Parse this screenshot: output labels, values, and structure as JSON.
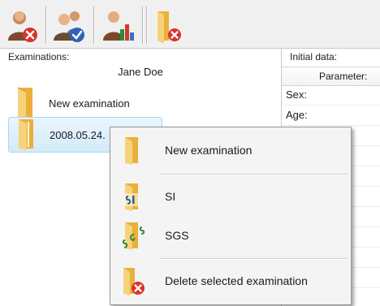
{
  "toolbar": {
    "buttons": [
      {
        "icon": "user-delete-icon"
      },
      {
        "icon": "users-check-icon"
      },
      {
        "icon": "user-chart-icon"
      },
      {
        "icon": "folder-delete-icon"
      }
    ]
  },
  "left_panel": {
    "label": "Examinations:",
    "patient_name": "Jane Doe",
    "items": [
      {
        "label": "New examination",
        "icon": "folder-icon",
        "selected": false
      },
      {
        "label": "2008.05.24.",
        "icon": "folder-open-icon",
        "selected": true
      }
    ]
  },
  "right_panel": {
    "label": "Initial data:",
    "column_header": "Parameter:",
    "rows": [
      {
        "label": "Sex:"
      },
      {
        "label": "Age:"
      }
    ]
  },
  "context_menu": {
    "items": [
      {
        "label": "New examination",
        "icon": "folder-icon"
      },
      {
        "label": "SI",
        "icon": "si-folder-icon"
      },
      {
        "label": "SGS",
        "icon": "sgs-folder-icon"
      },
      {
        "label": "Delete selected examination",
        "icon": "folder-delete-icon"
      }
    ]
  },
  "colors": {
    "selection_bg": "#d4ebfb",
    "selection_border": "#a9d5f3",
    "folder_yellow": "#f3c24c",
    "delete_red": "#d9342b",
    "check_blue": "#2f62b6"
  }
}
